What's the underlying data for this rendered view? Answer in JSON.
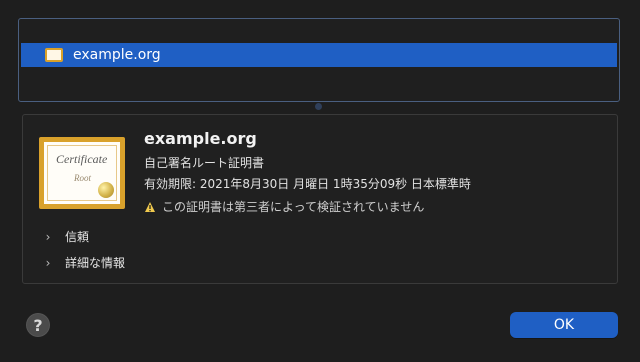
{
  "top_list": {
    "selected_item": "example.org"
  },
  "details": {
    "certificate_title": "Certificate",
    "certificate_subtitle": "Root",
    "name": "example.org",
    "type": "自己署名ルート証明書",
    "expiry": "有効期限: 2021年8月30日 月曜日 1時35分09秒 日本標準時",
    "warning": "この証明書は第三者によって検証されていません"
  },
  "sections": {
    "trust_label": "信頼",
    "details_label": "詳細な情報"
  },
  "footer": {
    "help_label": "?",
    "ok_label": "OK"
  },
  "colors": {
    "accent": "#1f5fc4",
    "background": "#1e1e1e",
    "warning": "#f0c94d"
  },
  "icons": {
    "certificate": "certificate-icon",
    "warning": "warning-icon",
    "chevron": "chevron-right-icon"
  }
}
